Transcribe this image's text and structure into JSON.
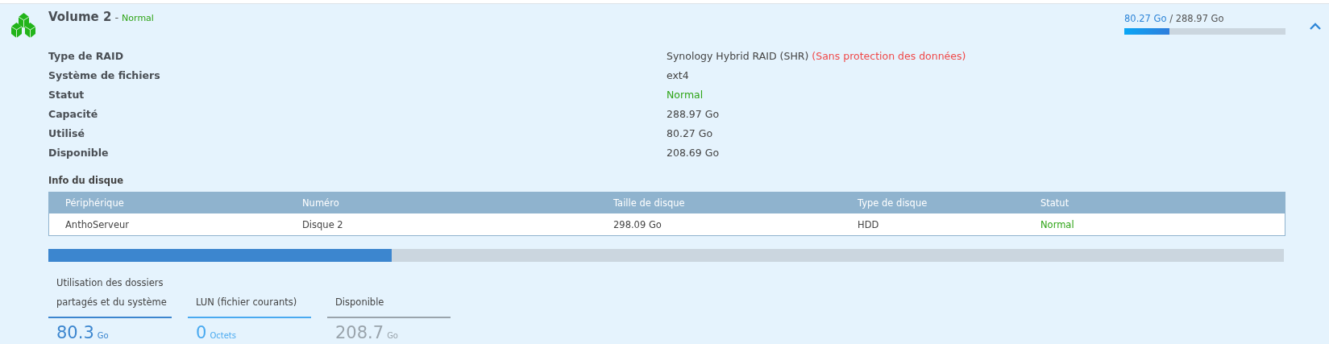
{
  "volume": {
    "title": "Volume 2",
    "separator": "-",
    "status": "Normal",
    "kind": "ok",
    "expanded": true
  },
  "usage": {
    "used": "80.27 Go",
    "divider": "/",
    "total": "288.97 Go",
    "level": 0.278
  },
  "properties": [
    {
      "label": "Type de RAID",
      "value": "Synology Hybrid RAID (SHR)",
      "note": "(Sans protection des données)",
      "kind": "plain"
    },
    {
      "label": "Système de fichiers",
      "value": "ext4",
      "kind": "plain"
    },
    {
      "label": "Statut",
      "value": "Normal",
      "kind": "ok"
    },
    {
      "label": "Capacité",
      "value": "288.97 Go",
      "kind": "plain"
    },
    {
      "label": "Utilisé",
      "value": "80.27 Go",
      "kind": "plain"
    },
    {
      "label": "Disponible",
      "value": "208.69 Go",
      "kind": "plain"
    }
  ],
  "disk_info": {
    "title": "Info du disque",
    "columns": [
      "Périphérique",
      "Numéro",
      "Taille de disque",
      "Type de disque",
      "Statut"
    ],
    "rows": [
      {
        "cells": [
          "AnthoServeur",
          "Disque 2",
          "298.09 Go",
          "HDD",
          "Normal"
        ],
        "kind": "ok"
      }
    ]
  },
  "breakdown": {
    "level": 0.278,
    "items": [
      {
        "label_lines": [
          "Utilisation des dossiers",
          "partagés et du système"
        ],
        "value": "80.3",
        "unit": "Go",
        "color": "#3c86cf"
      },
      {
        "label_lines": [
          "LUN (fichier courants)"
        ],
        "value": "0",
        "unit": "Octets",
        "color": "#4aaaf0"
      },
      {
        "label_lines": [
          "Disponible"
        ],
        "value": "208.7",
        "unit": "Go",
        "color": "#9aa4ac"
      }
    ]
  }
}
